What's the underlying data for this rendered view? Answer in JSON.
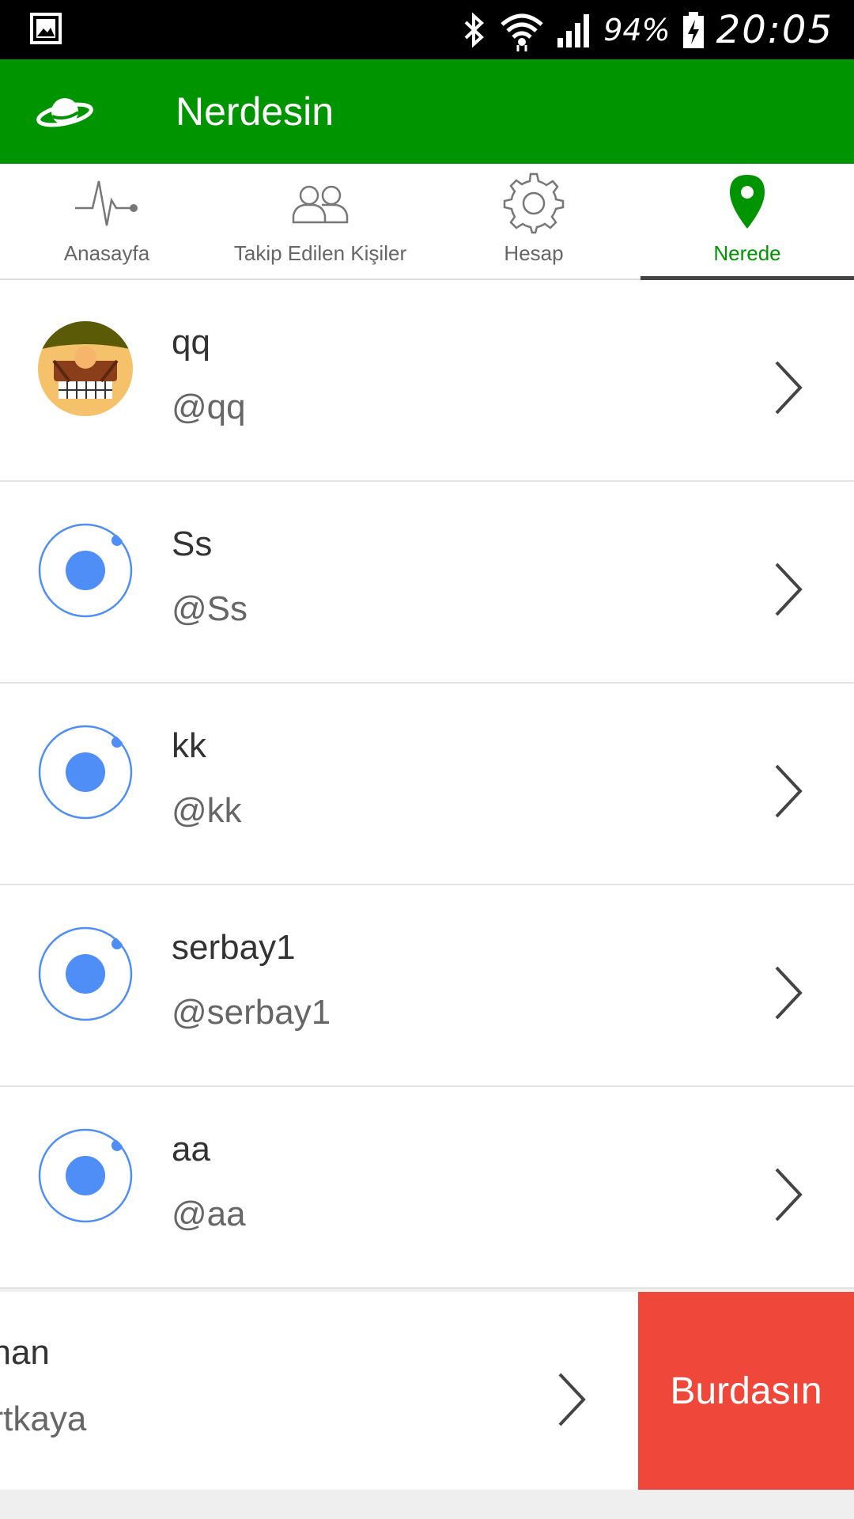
{
  "status_bar": {
    "battery_percent": "94%",
    "time": "20:05",
    "icons": [
      "gallery-icon",
      "bluetooth-icon",
      "wifi-icon",
      "signal-icon",
      "battery-charging-icon"
    ]
  },
  "app_bar": {
    "title": "Nerdesin",
    "logo_icon": "planet-icon",
    "color": "#009500"
  },
  "tabs": [
    {
      "label": "Anasayfa",
      "icon": "pulse-icon",
      "active": false
    },
    {
      "label": "Takip Edilen Kişiler",
      "icon": "people-icon",
      "active": false
    },
    {
      "label": "Hesap",
      "icon": "gear-icon",
      "active": false
    },
    {
      "label": "Nerede",
      "icon": "location-pin-icon",
      "active": true
    }
  ],
  "users": [
    {
      "name": "qq",
      "handle": "@qq",
      "avatar": "custom-avatar-image"
    },
    {
      "name": "Ss",
      "handle": "@Ss",
      "avatar": "ionic-logo-avatar"
    },
    {
      "name": "kk",
      "handle": "@kk",
      "avatar": "ionic-logo-avatar"
    },
    {
      "name": "serbay1",
      "handle": "@serbay1",
      "avatar": "ionic-logo-avatar"
    },
    {
      "name": "aa",
      "handle": "@aa",
      "avatar": "ionic-logo-avatar"
    }
  ],
  "swiped_user": {
    "name": "uzhan",
    "handle": "kurtkaya",
    "action_label": "Burdasın"
  },
  "colors": {
    "accent_green": "#009500",
    "action_red": "#ef473a",
    "avatar_blue": "#4f8ef7"
  }
}
